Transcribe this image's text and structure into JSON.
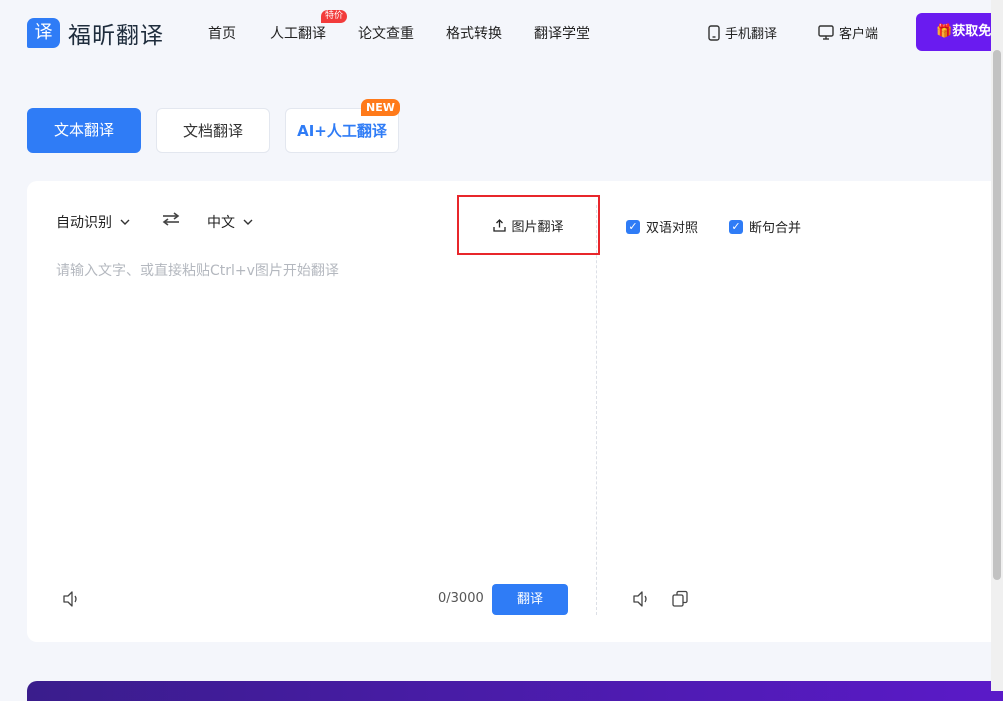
{
  "brand": {
    "logo_glyph": "译",
    "name": "福昕翻译"
  },
  "nav": {
    "items": [
      {
        "label": "首页"
      },
      {
        "label": "人工翻译",
        "badge": "特价"
      },
      {
        "label": "论文查重"
      },
      {
        "label": "格式转换"
      },
      {
        "label": "翻译学堂"
      }
    ]
  },
  "header_right": {
    "mobile": "手机翻译",
    "client": "客户端",
    "cta": "获取免"
  },
  "modes": {
    "text": "文本翻译",
    "doc": "文档翻译",
    "ai": "AI+人工翻译",
    "ai_badge": "NEW"
  },
  "source": {
    "lang_from": "自动识别",
    "lang_to": "中文",
    "image_translate": "图片翻译",
    "placeholder": "请输入文字、或直接粘贴Ctrl+v图片开始翻译",
    "count": "0/3000",
    "translate_button": "翻译"
  },
  "target": {
    "bilingual": "双语对照",
    "merge_sentences": "断句合并"
  },
  "colors": {
    "accent": "#2f7cf6",
    "cta": "#6a1bf0",
    "highlight": "#e8262b"
  }
}
